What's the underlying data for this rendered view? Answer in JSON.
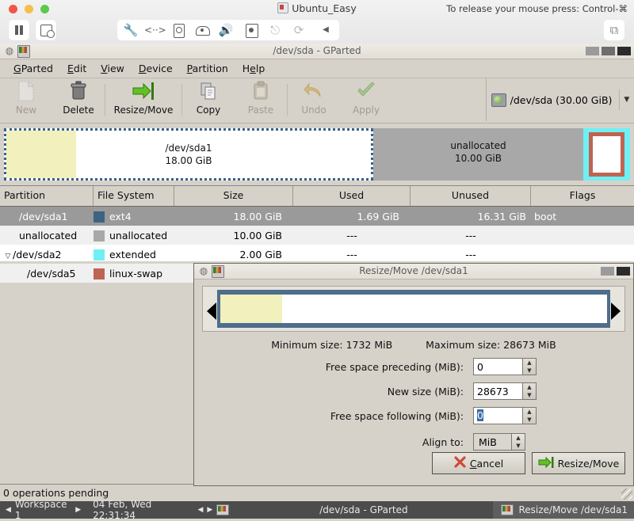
{
  "vm": {
    "title": "Ubuntu_Easy",
    "release_hint": "To release your mouse press: Control-⌘",
    "toolbar_icons": [
      "pause-icon",
      "snapshot-icon",
      "settings-wrench-icon",
      "network-icon",
      "harddisk-icon",
      "optical-drive-icon",
      "sound-icon",
      "camera-icon",
      "usb-icon",
      "sync-icon",
      "collapse-arrow-icon"
    ],
    "copy_icon": "windows-copy-icon"
  },
  "gparted": {
    "window_title": "/dev/sda - GParted",
    "menus": [
      {
        "label": "GParted",
        "accel": "G"
      },
      {
        "label": "Edit",
        "accel": "E"
      },
      {
        "label": "View",
        "accel": "V"
      },
      {
        "label": "Device",
        "accel": "D"
      },
      {
        "label": "Partition",
        "accel": "P"
      },
      {
        "label": "Help",
        "accel": "H"
      }
    ],
    "toolbar": [
      {
        "label": "New",
        "icon": "new-partition-icon",
        "enabled": false
      },
      {
        "label": "Delete",
        "icon": "trash-icon",
        "enabled": true
      },
      {
        "label": "Resize/Move",
        "icon": "resize-move-icon",
        "enabled": true
      },
      {
        "label": "Copy",
        "icon": "copy-icon",
        "enabled": true
      },
      {
        "label": "Paste",
        "icon": "paste-icon",
        "enabled": false
      },
      {
        "label": "Undo",
        "icon": "undo-icon",
        "enabled": false
      },
      {
        "label": "Apply",
        "icon": "apply-check-icon",
        "enabled": false
      }
    ],
    "device_selector": {
      "label": "/dev/sda  (30.00 GiB)",
      "icon": "harddisk-icon",
      "arrow": "▼"
    },
    "disk_graphic": [
      {
        "name": "/dev/sda1",
        "size": "18.00 GiB",
        "kind": "selected-partition"
      },
      {
        "name": "unallocated",
        "size": "10.00 GiB",
        "kind": "unallocated"
      },
      {
        "name": "",
        "size": "",
        "kind": "extended-with-swap"
      }
    ],
    "table": {
      "columns": [
        "Partition",
        "File System",
        "Size",
        "Used",
        "Unused",
        "Flags"
      ],
      "rows": [
        {
          "partition": "/dev/sda1",
          "filesystem": "ext4",
          "size": "18.00 GiB",
          "used": "1.69 GiB",
          "unused": "16.31 GiB",
          "flags": "boot",
          "swatch": "#3c6382",
          "selected": true,
          "indent": 1,
          "expander": ""
        },
        {
          "partition": "unallocated",
          "filesystem": "unallocated",
          "size": "10.00 GiB",
          "used": "---",
          "unused": "---",
          "flags": "",
          "swatch": "#a8a8a8",
          "selected": false,
          "indent": 1,
          "expander": ""
        },
        {
          "partition": "/dev/sda2",
          "filesystem": "extended",
          "size": "2.00 GiB",
          "used": "---",
          "unused": "---",
          "flags": "",
          "swatch": "#6ff0f4",
          "selected": false,
          "indent": 0,
          "expander": "▽"
        },
        {
          "partition": "/dev/sda5",
          "filesystem": "linux-swap",
          "size": "",
          "used": "",
          "unused": "",
          "flags": "",
          "swatch": "#bf6352",
          "selected": false,
          "indent": 2,
          "expander": ""
        }
      ]
    },
    "statusbar": "0 operations pending"
  },
  "dialog": {
    "title": "Resize/Move /dev/sda1",
    "minimum_size": "Minimum size: 1732 MiB",
    "maximum_size": "Maximum size: 28673 MiB",
    "fields": [
      {
        "label": "Free space preceding (MiB):",
        "value": "0",
        "selected": false
      },
      {
        "label": "New size (MiB):",
        "value": "28673",
        "selected": false
      },
      {
        "label": "Free space following (MiB):",
        "value": "0",
        "selected": true
      }
    ],
    "align_label": "Align to:",
    "align_value": "MiB",
    "cancel": {
      "label": "Cancel",
      "accel": "C",
      "icon": "cancel-x-icon"
    },
    "confirm": {
      "label": "Resize/Move",
      "icon": "resize-move-icon"
    }
  },
  "taskbar": {
    "workspace": "Workspace 1",
    "prev_arrow": "◀",
    "next_arrow": "▶",
    "clock": "04 Feb, Wed 22:31:34",
    "pager_prev": "◀",
    "pager_next": "▶",
    "windows": [
      {
        "label": "/dev/sda - GParted",
        "active": false
      },
      {
        "label": "Resize/Move /dev/sda1",
        "active": true
      }
    ]
  }
}
